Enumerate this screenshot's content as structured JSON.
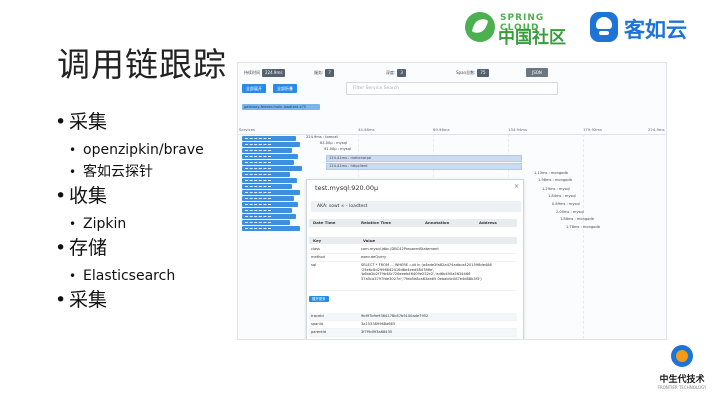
{
  "slide": {
    "title": "调用链跟踪",
    "bullets": [
      {
        "text": "采集",
        "children": [
          "openzipkin/brave",
          "客如云探针"
        ]
      },
      {
        "text": "收集",
        "children": [
          "Zipkin"
        ]
      },
      {
        "text": "存储",
        "children": [
          "Elasticsearch"
        ]
      },
      {
        "text": "采集",
        "children": []
      }
    ]
  },
  "logos": {
    "spring_cloud_small": "SPRING CLOUD",
    "spring_cloud_big": "中国社区",
    "keruyun": "客如云",
    "footer_main": "中生代技术",
    "footer_sub": "FRONTIER TECHNOLOGY"
  },
  "screenshot": {
    "filters": {
      "duration_label": "持续时间",
      "duration_value": "224.9ms",
      "services_label": "服务:",
      "services_value": "7",
      "depth_label": "深度:",
      "depth_value": "3",
      "span_label": "Span总数:",
      "span_value": "75",
      "download_label": "JSON"
    },
    "buttons": {
      "expand": "全部展开",
      "collapse": "全部折叠"
    },
    "search_placeholder": "Filter Service Search",
    "trace_pill": "gateway-feeder-main-loadtest x75",
    "ruler_ticks": [
      "Services",
      "44.98ms",
      "89.96ms",
      "134.94ms",
      "179.92ms",
      "224.9ms"
    ],
    "span_labels": [
      "224.9ms : tomcat",
      "83.00μ : mysql",
      "91.00μ : mysql",
      "124.41ms : mehenarpe",
      "124.41ms : httpclient",
      "1.13ms : mongodb",
      "1.98ms : mongodb",
      "1.29ms : mysql",
      "1.84ms : mysql",
      "0.89ms : mysql",
      "2.00ms : mysql",
      "1.88ms : mongodb",
      "1.78ms : mongodb"
    ],
    "modal": {
      "title": "test.mysql:920.00μ",
      "close": "×",
      "aka": "AKA: sowt ∞ - loadtest",
      "table_headers": [
        "Date Time",
        "Relative Time",
        "Annotation",
        "Address"
      ],
      "kv_headers": [
        "Key",
        "Value"
      ],
      "kv_rows": [
        {
          "k": "class",
          "v": "com.mysql.jdbc.JDBC42PreparedStatement"
        },
        {
          "k": "method",
          "v": "executeQuery"
        },
        {
          "k": "sql",
          "v": "SELECT * FROM ... WHERE .uid in (a4ade2fa82a474adbca4201598de486 '25e6c8d2996642416d8e4eed584786e', 'b6bb2b2f79b48c726eeeb46409e252c2','ad6b490a5634466 37a5ca3797fde3027d','7feb5e8ca63ae65 0ebab4c087e4d88b3f5')"
        }
      ],
      "more_button": "展开更多",
      "id_rows": [
        {
          "k": "traceId",
          "v": "9b9f7b9e9364178b57b9100ade7952"
        },
        {
          "k": "spanId",
          "v": "3a153389968a665"
        },
        {
          "k": "parentId",
          "v": "3f7f9d9f3a68435"
        }
      ]
    }
  }
}
